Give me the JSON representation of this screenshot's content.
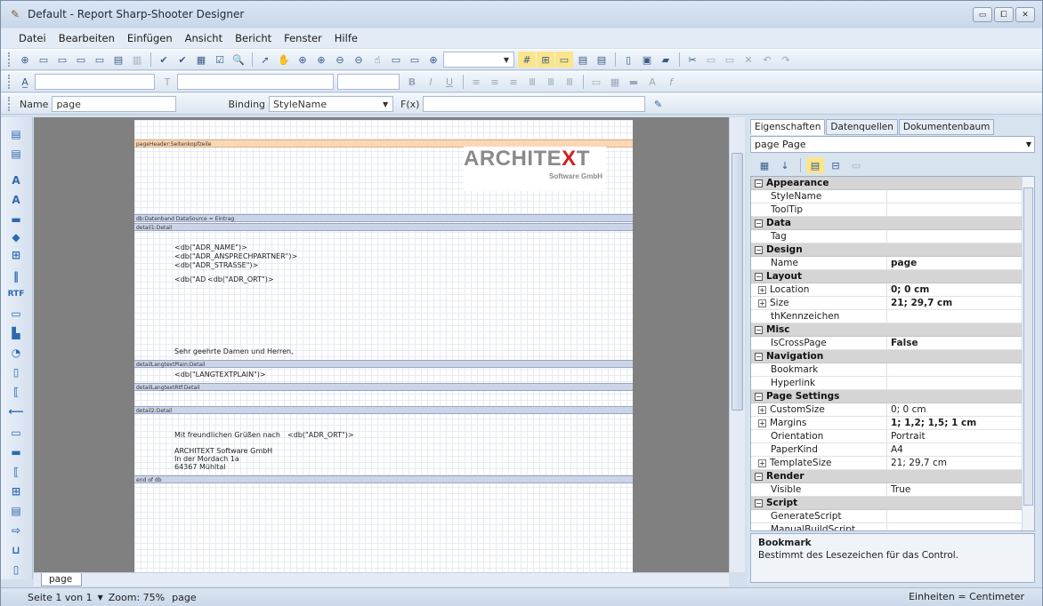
{
  "window": {
    "title": "Default - Report Sharp-Shooter Designer",
    "min": "▭",
    "max": "⧠",
    "close": "✕"
  },
  "menu": [
    "Datei",
    "Bearbeiten",
    "Einfügen",
    "Ansicht",
    "Bericht",
    "Fenster",
    "Hilfe"
  ],
  "toolbar2": {
    "style_combo": "",
    "font_combo": "",
    "size_combo": ""
  },
  "toolbar3": {
    "name_label": "Name",
    "name_value": "page",
    "binding_label": "Binding",
    "binding_value": "StyleName",
    "fx_label": "F(x)",
    "fx_value": ""
  },
  "report": {
    "page_header": "pageHeader:Seitenkopfzeile",
    "logo_main": "ARCHITE",
    "logo_x": "X",
    "logo_t": "T",
    "logo_sub": "Software GmbH",
    "databand": "db:Datenband  DataSource = Eintrag",
    "detail1": "detail1:Detail",
    "f_name": "<db(\"ADR_NAME\")>",
    "f_ansp": "<db(\"ADR_ANSPRECHPARTNER\")>",
    "f_strasse": "<db(\"ADR_STRASSE\")>",
    "f_ad": "<db(\"AD",
    "f_ort": "<db(\"ADR_ORT\")>",
    "salutation": "Sehr geehrte Damen und Herren,",
    "detail_plain": "detailLangtextPlain:Detail",
    "f_langtext": "<db(\"LANGTEXTPLAIN\")>",
    "detail_rtf": "detailLangtextRtf:Detail",
    "detail2": "detail2:Detail",
    "greeting": "Mit freundlichen Grüßen nach",
    "greeting_ort": "<db(\"ADR_ORT\")>",
    "sender1": "ARCHITEXT Software GmbH",
    "sender2": "In der Mordach 1a",
    "sender3": "64367 Mühltal",
    "end": "end of db"
  },
  "page_tab": "page",
  "panel": {
    "tabs": [
      "Eigenschaften",
      "Datenquellen",
      "Dokumentenbaum"
    ],
    "object": "page Page",
    "groups": [
      {
        "name": "Appearance",
        "rows": [
          {
            "n": "StyleName",
            "v": ""
          },
          {
            "n": "ToolTip",
            "v": ""
          }
        ]
      },
      {
        "name": "Data",
        "rows": [
          {
            "n": "Tag",
            "v": ""
          }
        ]
      },
      {
        "name": "Design",
        "rows": [
          {
            "n": "Name",
            "v": "page",
            "bold": true
          }
        ]
      },
      {
        "name": "Layout",
        "rows": [
          {
            "n": "Location",
            "v": "0; 0 cm",
            "bold": true,
            "exp": true
          },
          {
            "n": "Size",
            "v": "21; 29,7 cm",
            "bold": true,
            "exp": true
          },
          {
            "n": "thKennzeichen",
            "v": ""
          }
        ]
      },
      {
        "name": "Misc",
        "rows": [
          {
            "n": "IsCrossPage",
            "v": "False",
            "bold": true
          }
        ]
      },
      {
        "name": "Navigation",
        "rows": [
          {
            "n": "Bookmark",
            "v": ""
          },
          {
            "n": "Hyperlink",
            "v": ""
          }
        ]
      },
      {
        "name": "Page Settings",
        "rows": [
          {
            "n": "CustomSize",
            "v": "0; 0 cm",
            "exp": true
          },
          {
            "n": "Margins",
            "v": "1; 1,2; 1,5; 1 cm",
            "bold": true,
            "exp": true
          },
          {
            "n": "Orientation",
            "v": "Portrait"
          },
          {
            "n": "PaperKind",
            "v": "A4"
          },
          {
            "n": "TemplateSize",
            "v": "21; 29,7 cm",
            "exp": true
          }
        ]
      },
      {
        "name": "Render",
        "rows": [
          {
            "n": "Visible",
            "v": "True"
          }
        ]
      },
      {
        "name": "Script",
        "rows": [
          {
            "n": "GenerateScript",
            "v": ""
          },
          {
            "n": "ManualBuildScript",
            "v": ""
          }
        ]
      }
    ],
    "desc_title": "Bookmark",
    "desc_text": "Bestimmt des Lesezeichen für das Control."
  },
  "status": {
    "pages": "Seite 1 von 1",
    "zoom": "Zoom: 75%",
    "page": "page",
    "units": "Einheiten = Centimeter"
  }
}
